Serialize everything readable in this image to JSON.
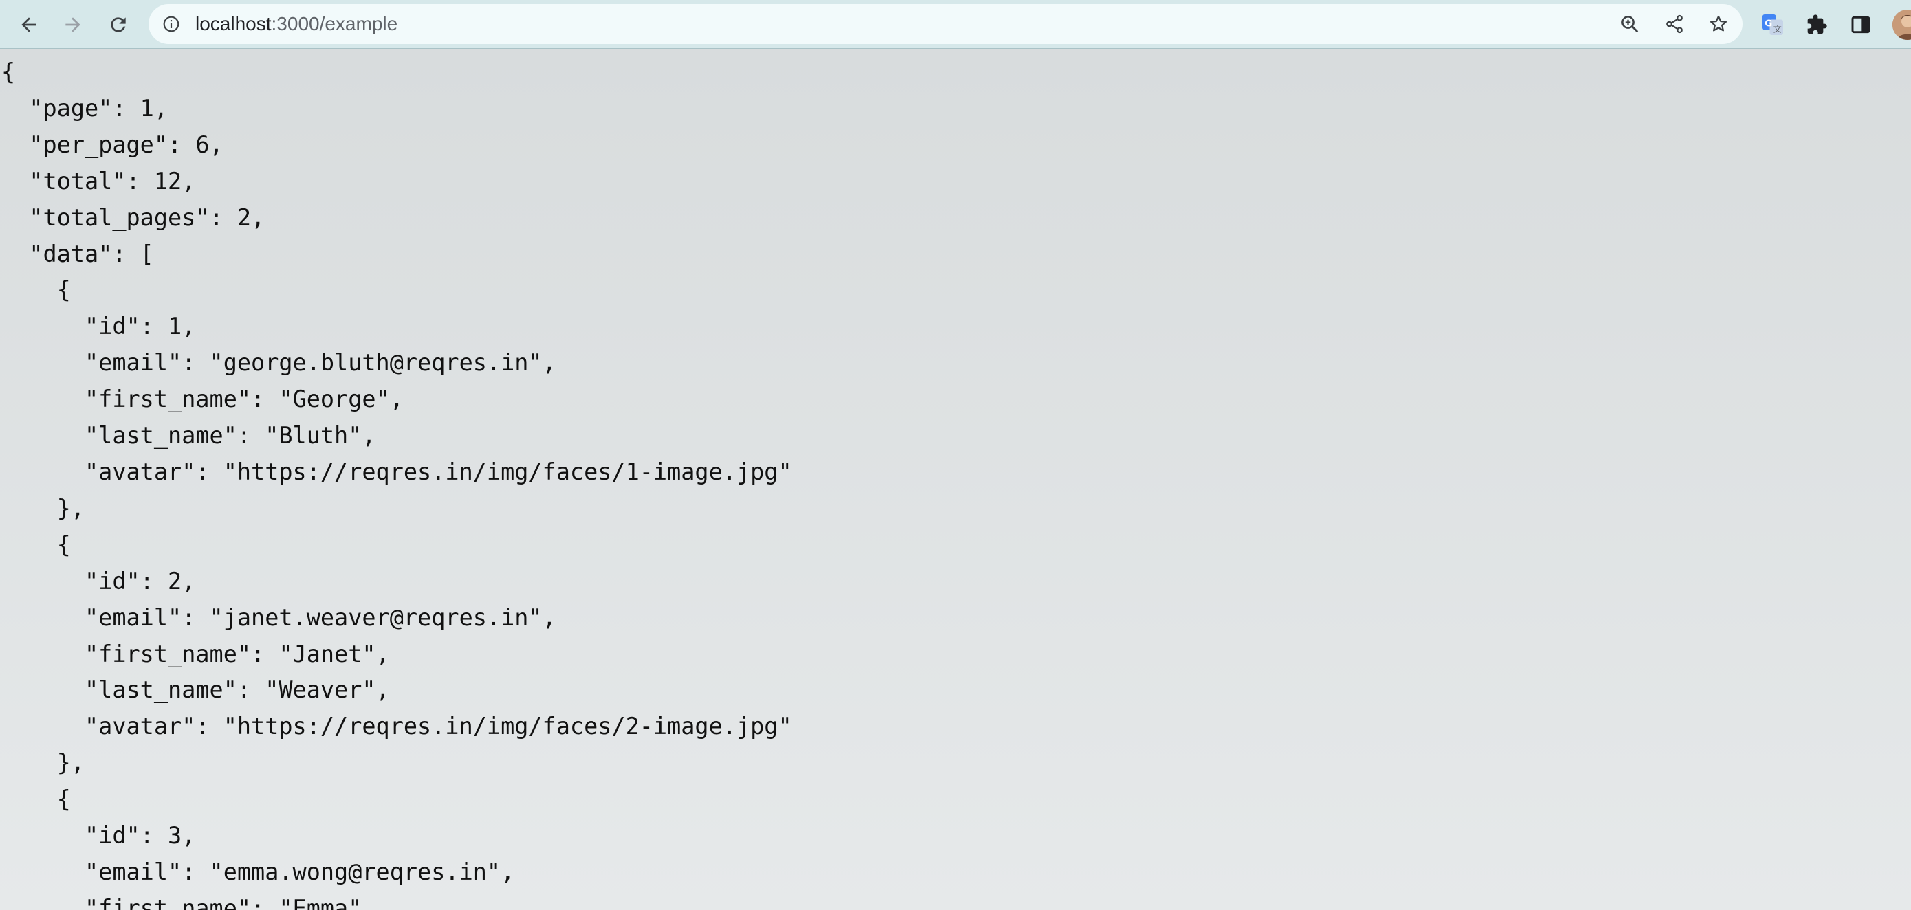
{
  "browser": {
    "url_host": "localhost",
    "url_path": ":3000/example",
    "icons": {
      "back": "back-arrow-icon",
      "forward": "forward-arrow-icon",
      "reload": "reload-icon",
      "site_info": "info-icon",
      "zoom": "zoom-icon",
      "share": "share-icon",
      "bookmark": "star-icon",
      "translate": "google-translate-icon",
      "extensions": "puzzle-icon",
      "side_panel": "side-panel-icon",
      "profile": "avatar"
    },
    "colors": {
      "toolbar": "#d6e8ea",
      "omnibox": "#f2fafb",
      "page_background": "#dadfe0"
    }
  },
  "json_lines": [
    "{",
    "  \"page\": 1,",
    "  \"per_page\": 6,",
    "  \"total\": 12,",
    "  \"total_pages\": 2,",
    "  \"data\": [",
    "    {",
    "      \"id\": 1,",
    "      \"email\": \"george.bluth@reqres.in\",",
    "      \"first_name\": \"George\",",
    "      \"last_name\": \"Bluth\",",
    "      \"avatar\": \"https://reqres.in/img/faces/1-image.jpg\"",
    "    },",
    "    {",
    "      \"id\": 2,",
    "      \"email\": \"janet.weaver@reqres.in\",",
    "      \"first_name\": \"Janet\",",
    "      \"last_name\": \"Weaver\",",
    "      \"avatar\": \"https://reqres.in/img/faces/2-image.jpg\"",
    "    },",
    "    {",
    "      \"id\": 3,",
    "      \"email\": \"emma.wong@reqres.in\",",
    "      \"first_name\": \"Emma\","
  ]
}
